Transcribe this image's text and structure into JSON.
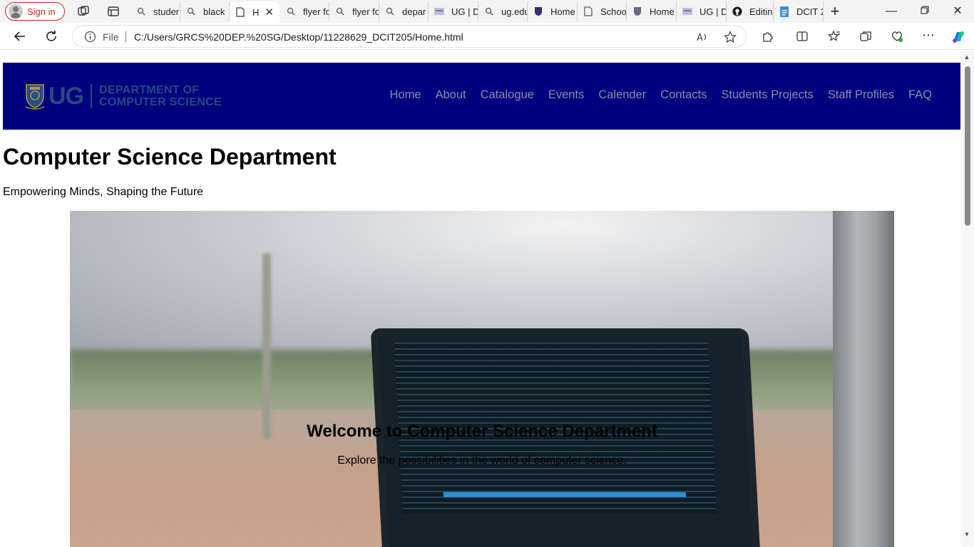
{
  "browser": {
    "signin_label": "Sign in",
    "tabs": [
      {
        "label": "studer",
        "icon": "search-icon"
      },
      {
        "label": "black",
        "icon": "search-icon"
      },
      {
        "label": "H",
        "icon": "page-icon",
        "active": true
      },
      {
        "label": "flyer fo",
        "icon": "search-icon"
      },
      {
        "label": "flyer fo",
        "icon": "search-icon"
      },
      {
        "label": "depar",
        "icon": "search-icon"
      },
      {
        "label": "UG | D",
        "icon": "site-icon"
      },
      {
        "label": "ug.edu",
        "icon": "search-icon"
      },
      {
        "label": "Home",
        "icon": "crest-icon"
      },
      {
        "label": "Schoo",
        "icon": "page-icon"
      },
      {
        "label": "Home",
        "icon": "crest-icon"
      },
      {
        "label": "UG | D",
        "icon": "site-icon"
      },
      {
        "label": "Editin",
        "icon": "github-icon"
      },
      {
        "label": "DCIT 2",
        "icon": "docs-icon"
      }
    ],
    "address": {
      "scheme_label": "File",
      "url": "C:/Users/GRCS%20DEP.%20SG/Desktop/11228629_DCIT205/Home.html"
    }
  },
  "site": {
    "logo": {
      "ug": "UG",
      "dept_line1": "DEPARTMENT OF",
      "dept_line2": "COMPUTER SCIENCE"
    },
    "nav": [
      "Home",
      "About",
      "Catalogue",
      "Events",
      "Calender",
      "Contacts",
      "Students Projects",
      "Staff Profiles",
      "FAQ"
    ],
    "title": "Computer Science Department",
    "tagline": "Empowering Minds, Shaping the Future",
    "hero": {
      "heading": "Welcome to Computer Science Department",
      "subtext": "Explore the possibilities in the world of computer science."
    }
  },
  "colors": {
    "header_bg": "#00007f",
    "nav_text": "#8a8ba2",
    "signin_accent": "#c42b1c"
  }
}
